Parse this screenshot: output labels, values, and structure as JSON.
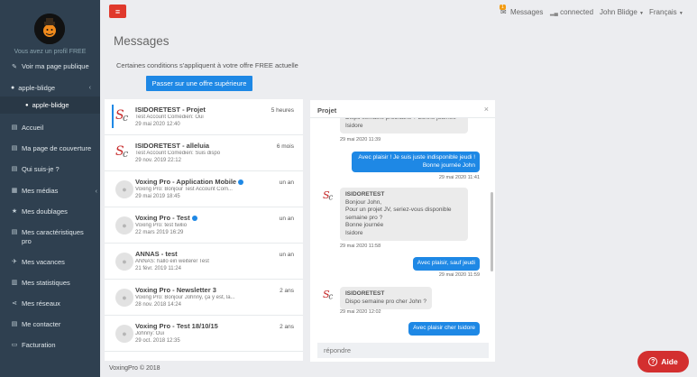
{
  "sidebar": {
    "profile_note": "Vous avez un profil FREE",
    "public_page": "Voir ma page publique",
    "user": "apple-blidge",
    "sub_user": "apple-blidge",
    "menu": [
      {
        "label": "Accueil",
        "icon": "home-icon"
      },
      {
        "label": "Ma page de couverture",
        "icon": "cover-icon"
      },
      {
        "label": "Qui suis-je ?",
        "icon": "id-card-icon"
      },
      {
        "label": "Mes médias",
        "icon": "grid-icon"
      },
      {
        "label": "Mes doublages",
        "icon": "star-icon"
      },
      {
        "label": "Mes caractéristiques pro",
        "icon": "list-icon"
      },
      {
        "label": "Mes vacances",
        "icon": "plane-icon"
      },
      {
        "label": "Mes statistiques",
        "icon": "chart-icon"
      },
      {
        "label": "Mes réseaux",
        "icon": "share-icon"
      },
      {
        "label": "Me contacter",
        "icon": "contact-icon"
      },
      {
        "label": "Facturation",
        "icon": "billing-icon"
      }
    ]
  },
  "topbar": {
    "messages": "Messages",
    "messages_badge": "1",
    "connected": "connected",
    "user": "John Blidge",
    "language": "Français"
  },
  "main": {
    "title": "Messages",
    "conditions": "Certaines conditions s'appliquent à votre offre FREE actuelle",
    "upgrade": "Passer sur une offre supérieure"
  },
  "conversations": [
    {
      "name": "ISIDORETEST - Projet",
      "preview": "Test Account Comédien: Oui",
      "date": "29 mai 2020 12:40",
      "when": "5 heures",
      "avatar": "logo",
      "verified": false
    },
    {
      "name": "ISIDORETEST - alleluia",
      "preview": "Test Account Comédien: Suis dispo",
      "date": "29 nov. 2019 22:12",
      "when": "6 mois",
      "avatar": "logo",
      "verified": false
    },
    {
      "name": "Voxing Pro - Application Mobile",
      "preview": "Voxing Pro: Bonjour Test Account Com...",
      "date": "29 mai 2019 18:45",
      "when": "un an",
      "avatar": "default",
      "verified": true
    },
    {
      "name": "Voxing Pro - Test",
      "preview": "Voxing Pro: test twilio",
      "date": "22 mars 2019 16:29",
      "when": "un an",
      "avatar": "default",
      "verified": true
    },
    {
      "name": "ANNAS - test",
      "preview": "ANNAS: hallo ein weiterer Test",
      "date": "21 févr. 2019 11:24",
      "when": "un an",
      "avatar": "default",
      "verified": false
    },
    {
      "name": "Voxing Pro - Newsletter 3",
      "preview": "Voxing Pro: Bonjour Johnny, ça y est, la...",
      "date": "28 nov. 2018 14:24",
      "when": "2 ans",
      "avatar": "default",
      "verified": false
    },
    {
      "name": "Voxing Pro - Test 18/10/15",
      "preview": "Johnny: Oui",
      "date": "29 oct. 2018 12:35",
      "when": "2 ans",
      "avatar": "default",
      "verified": false
    }
  ],
  "chat": {
    "title": "Projet",
    "partial_message": "Dispo semaine prochaine ? Bonne journée Isidore",
    "partial_ts": "29 mai 2020 11:39",
    "msg1": "Avec plaisir ! Je suis juste indisponible jeudi ! Bonne journée John",
    "msg1_ts": "29 mai 2020 11:41",
    "msg2_sender": "ISIDORETEST",
    "msg2_lines": [
      "Bonjour John,",
      "Pour un projet JV, seriez-vous disponible",
      "semaine pro ?",
      "Bonne journée",
      "Isidore"
    ],
    "msg2_ts": "29 mai 2020 11:58",
    "msg3": "Avec plaisir, sauf jeudi",
    "msg3_ts": "29 mai 2020 11:59",
    "msg4_sender": "ISIDORETEST",
    "msg4": "Dispo semaine pro cher John ?",
    "msg4_ts": "29 mai 2020 12:02",
    "msg5": "Avec plaisir cher Isidore",
    "reply_placeholder": "répondre"
  },
  "footer": "VoxingPro © 2018",
  "help": "Aide",
  "colors": {
    "accent": "#1e88e5",
    "danger": "#e0392c",
    "sidebar": "#2f4050"
  }
}
